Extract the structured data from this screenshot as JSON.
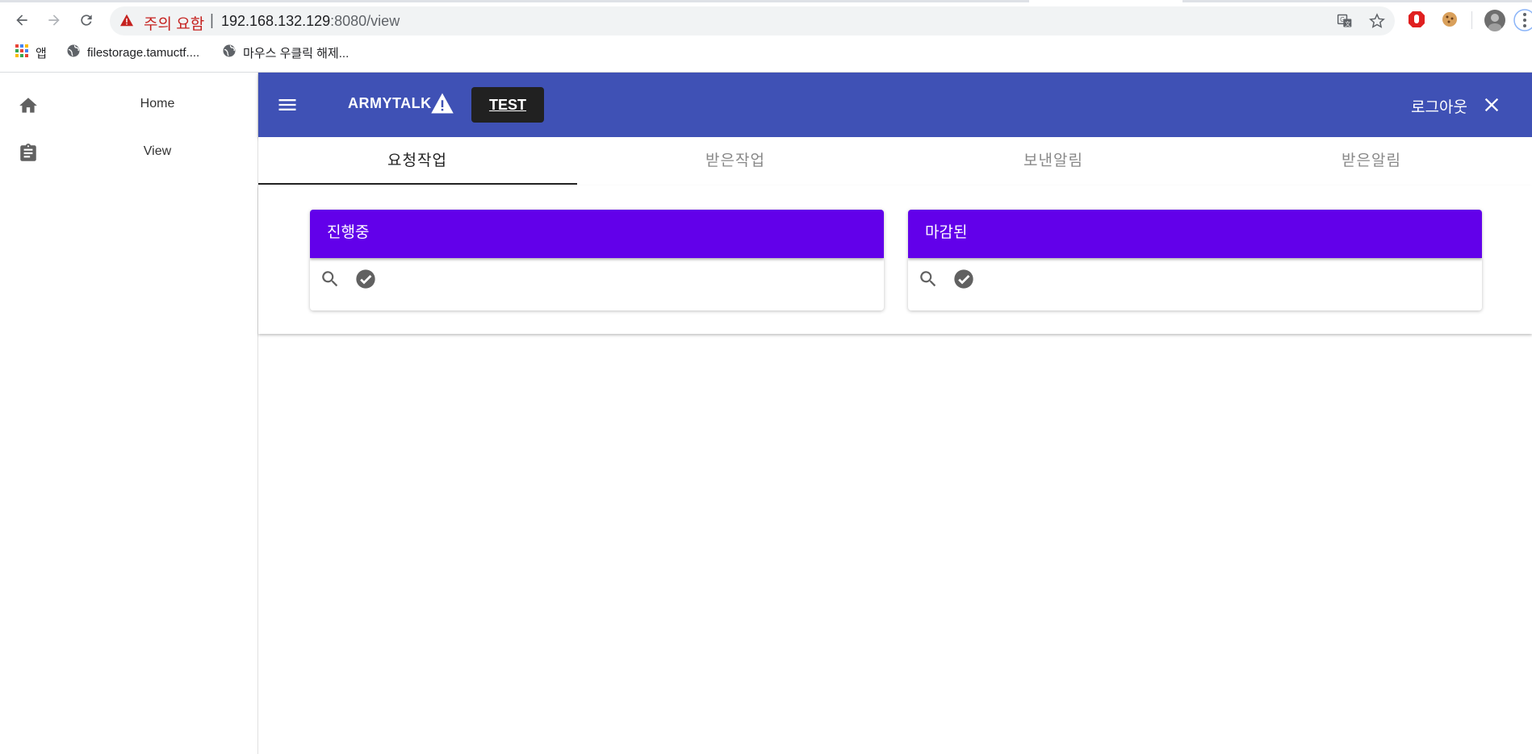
{
  "browser": {
    "url_warning": "주의 요함",
    "url_separator": "|",
    "url_host": "192.168.132.129",
    "url_rest": ":8080/view",
    "bookmarks": [
      {
        "label": "앱",
        "icon": "apps-grid-icon"
      },
      {
        "label": "filestorage.tamuctf....",
        "icon": "globe-icon"
      },
      {
        "label": "마우스 우클릭 해제...",
        "icon": "globe-icon"
      }
    ]
  },
  "sidebar": {
    "items": [
      {
        "label": "Home",
        "icon": "home-icon"
      },
      {
        "label": "View",
        "icon": "clipboard-icon"
      }
    ]
  },
  "appbar": {
    "brand": "ARMYTALK",
    "test_button": "TEST",
    "logout": "로그아웃"
  },
  "tabs": [
    {
      "label": "요청작업",
      "active": true
    },
    {
      "label": "받은작업",
      "active": false
    },
    {
      "label": "보낸알림",
      "active": false
    },
    {
      "label": "받은알림",
      "active": false
    }
  ],
  "cards": [
    {
      "title": "진행중"
    },
    {
      "title": "마감된"
    }
  ],
  "colors": {
    "appbar": "#3f51b5",
    "card_header": "#6200ea",
    "test_button": "#212121"
  }
}
